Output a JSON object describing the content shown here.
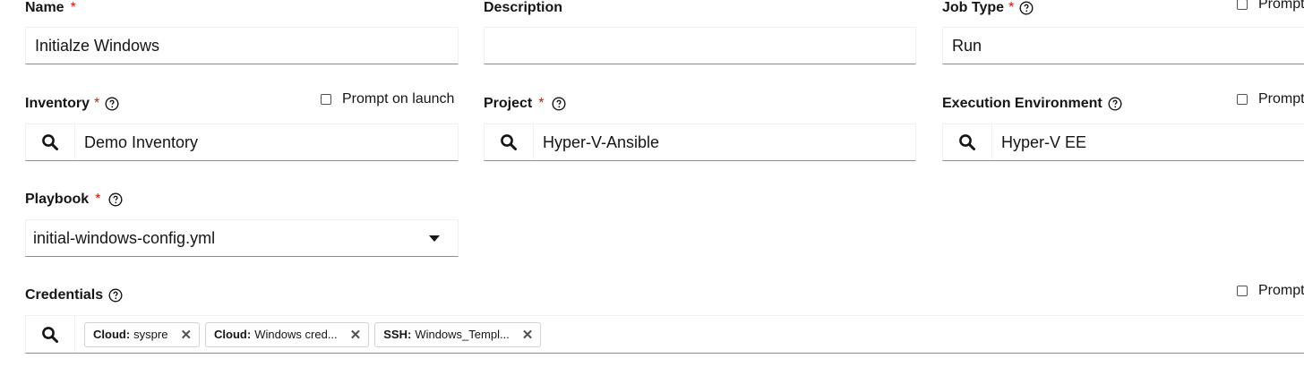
{
  "form": {
    "name": {
      "label": "Name",
      "required": "*",
      "value": "Initialze Windows"
    },
    "description": {
      "label": "Description",
      "value": ""
    },
    "job_type": {
      "label": "Job Type",
      "required": "*",
      "value": "Run",
      "prompt_label": "Prompt"
    },
    "inventory": {
      "label": "Inventory",
      "required": "*",
      "value": "Demo Inventory",
      "prompt_label": "Prompt on launch"
    },
    "project": {
      "label": "Project",
      "required": "*",
      "value": "Hyper-V-Ansible"
    },
    "execution_environment": {
      "label": "Execution Environment",
      "value": "Hyper-V EE",
      "prompt_label": "Prompt"
    },
    "playbook": {
      "label": "Playbook",
      "required": "*",
      "value": "initial-windows-config.yml"
    },
    "credentials": {
      "label": "Credentials",
      "prompt_label": "Prompt",
      "chips": [
        {
          "kind": "Cloud:",
          "name": "syspre"
        },
        {
          "kind": "Cloud:",
          "name": "Windows cred..."
        },
        {
          "kind": "SSH:",
          "name": "Windows_Templ..."
        }
      ]
    }
  },
  "icons": {
    "help": "question-circle-icon",
    "search": "search-icon",
    "remove": "close-icon",
    "caret": "caret-down-icon"
  },
  "colors": {
    "required": "#c9190b",
    "text": "#151515",
    "border_bottom": "#8a8d90"
  }
}
